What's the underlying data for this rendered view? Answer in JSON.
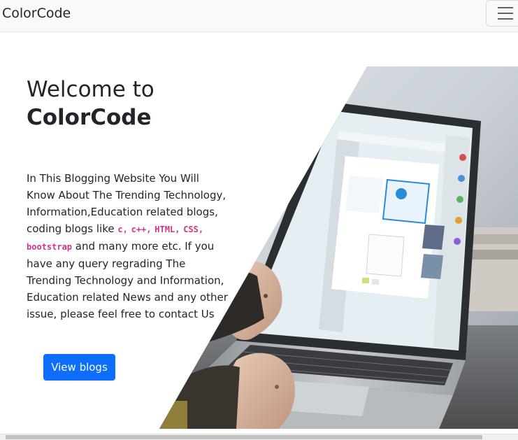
{
  "navbar": {
    "brand": "ColorCode",
    "toggler_icon": "hamburger-menu-icon"
  },
  "hero": {
    "heading_line1": "Welcome to",
    "heading_line2": "ColorCode",
    "intro_part1": "In This Blogging Website You Will Know About The Trending Technology, Information,Education related blogs, coding blogs like ",
    "code_tags": [
      "c,",
      "c++,",
      "HTML,",
      "CSS,",
      "bootstrap"
    ],
    "intro_part2": " and many more etc. If you have any query regrading The Trending Technology and Information, Education related News and any other issue, please feel free to contact Us",
    "button_label": "View blogs",
    "image_subject": "hands typing on a laptop"
  },
  "colors": {
    "navbar_bg": "#f8f9fa",
    "primary": "#0d6efd",
    "code": "#d63384",
    "text": "#212529"
  }
}
